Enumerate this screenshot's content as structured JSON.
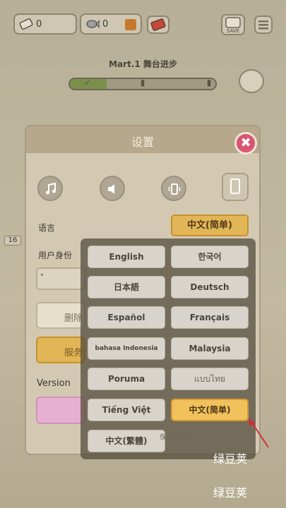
{
  "hud": {
    "ticket_count": "0",
    "fish_count": "0",
    "save_label": "SAVE"
  },
  "progress": {
    "title": "Mart.1 舞台进步",
    "fill": 0.25
  },
  "settings": {
    "title": "设置",
    "language_label": "语言",
    "language_value": "中文(简单)",
    "user_id_label": "用户身份",
    "user_id_value": "\"",
    "delete_label": "删除",
    "service_label": "服务",
    "version_label": "Version"
  },
  "language_menu": {
    "options": [
      "English",
      "한국어",
      "日本語",
      "Deutsch",
      "Español",
      "Français",
      "bahasa Indonesia",
      "Malaysia",
      "Poruma",
      "แบบไทย",
      "Tiếng Việt",
      "中文(简单)",
      "中文(繁體)"
    ],
    "selected": "中文(简单)",
    "note": "保存在设备"
  },
  "side_badge": "16",
  "watermark": [
    "绿豆荚",
    "绿豆荚"
  ],
  "colors": {
    "accent": "#e2b556",
    "close": "#d95672",
    "arrow": "#d0303a"
  }
}
